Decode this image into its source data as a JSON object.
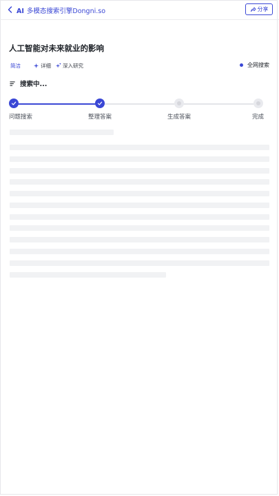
{
  "header": {
    "app_title_prefix": "AI",
    "app_title": "多模态搜索引擎Dongni.so",
    "share_label": "分享"
  },
  "page": {
    "title": "人工智能对未来就业的影响"
  },
  "modes": {
    "simple": "简洁",
    "detail": "详细",
    "research": "深入研究",
    "web_search": "全网搜索"
  },
  "status": {
    "label": "搜索中..."
  },
  "stepper": {
    "steps": [
      {
        "label": "问题搜索",
        "state": "done"
      },
      {
        "label": "整理答案",
        "state": "done"
      },
      {
        "label": "生成答案",
        "state": "pending"
      },
      {
        "label": "完成",
        "state": "pending"
      }
    ]
  },
  "colors": {
    "accent": "#3a47d5",
    "skeleton": "#f1f2f4",
    "pending": "#e3e4e8"
  }
}
